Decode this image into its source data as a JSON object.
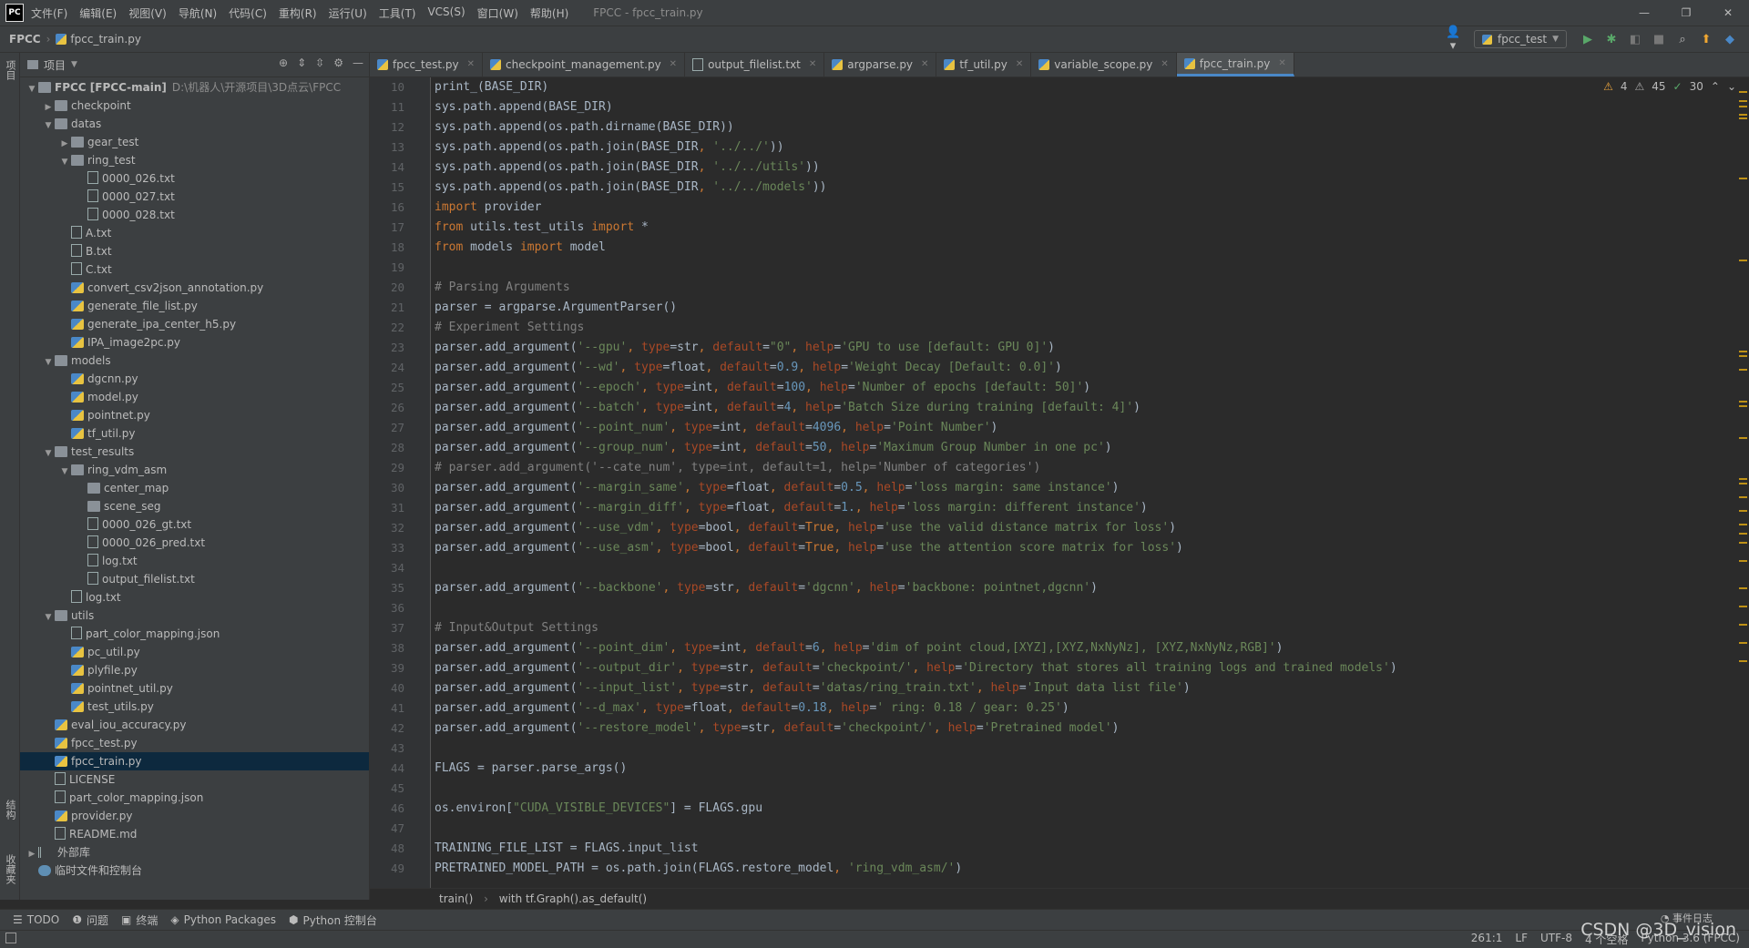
{
  "app": {
    "logo": "PC",
    "window_title": "FPCC - fpcc_train.py"
  },
  "menu": [
    "文件(F)",
    "编辑(E)",
    "视图(V)",
    "导航(N)",
    "代码(C)",
    "重构(R)",
    "运行(U)",
    "工具(T)",
    "VCS(S)",
    "窗口(W)",
    "帮助(H)"
  ],
  "window_controls": {
    "minimize": "—",
    "maximize": "❐",
    "close": "✕"
  },
  "nav": {
    "project": "FPCC",
    "file": "fpcc_train.py",
    "run_config": "fpcc_test"
  },
  "left_strip": {
    "top": "项目",
    "mid": "结构",
    "bottom": "收藏夹"
  },
  "project_panel": {
    "title": "项目",
    "tree": [
      {
        "depth": 0,
        "type": "folder",
        "open": true,
        "name": "FPCC [FPCC-main]",
        "path": "D:\\机器人\\开源项目\\3D点云\\FPCC"
      },
      {
        "depth": 1,
        "type": "folder",
        "open": false,
        "name": "checkpoint"
      },
      {
        "depth": 1,
        "type": "folder",
        "open": true,
        "name": "datas"
      },
      {
        "depth": 2,
        "type": "folder",
        "open": false,
        "name": "gear_test"
      },
      {
        "depth": 2,
        "type": "folder",
        "open": true,
        "name": "ring_test"
      },
      {
        "depth": 3,
        "type": "file",
        "name": "0000_026.txt"
      },
      {
        "depth": 3,
        "type": "file",
        "name": "0000_027.txt"
      },
      {
        "depth": 3,
        "type": "file",
        "name": "0000_028.txt"
      },
      {
        "depth": 2,
        "type": "file",
        "name": "A.txt"
      },
      {
        "depth": 2,
        "type": "file",
        "name": "B.txt"
      },
      {
        "depth": 2,
        "type": "file",
        "name": "C.txt"
      },
      {
        "depth": 2,
        "type": "py",
        "name": "convert_csv2json_annotation.py"
      },
      {
        "depth": 2,
        "type": "py",
        "name": "generate_file_list.py"
      },
      {
        "depth": 2,
        "type": "py",
        "name": "generate_ipa_center_h5.py"
      },
      {
        "depth": 2,
        "type": "py",
        "name": "IPA_image2pc.py"
      },
      {
        "depth": 1,
        "type": "folder",
        "open": true,
        "name": "models"
      },
      {
        "depth": 2,
        "type": "py",
        "name": "dgcnn.py"
      },
      {
        "depth": 2,
        "type": "py",
        "name": "model.py"
      },
      {
        "depth": 2,
        "type": "py",
        "name": "pointnet.py"
      },
      {
        "depth": 2,
        "type": "py",
        "name": "tf_util.py"
      },
      {
        "depth": 1,
        "type": "folder",
        "open": true,
        "name": "test_results"
      },
      {
        "depth": 2,
        "type": "folder",
        "open": true,
        "name": "ring_vdm_asm"
      },
      {
        "depth": 3,
        "type": "folder",
        "leaf": true,
        "name": "center_map"
      },
      {
        "depth": 3,
        "type": "folder",
        "leaf": true,
        "name": "scene_seg"
      },
      {
        "depth": 3,
        "type": "file",
        "name": "0000_026_gt.txt"
      },
      {
        "depth": 3,
        "type": "file",
        "name": "0000_026_pred.txt"
      },
      {
        "depth": 3,
        "type": "file",
        "name": "log.txt"
      },
      {
        "depth": 3,
        "type": "file",
        "name": "output_filelist.txt"
      },
      {
        "depth": 2,
        "type": "file",
        "name": "log.txt"
      },
      {
        "depth": 1,
        "type": "folder",
        "open": true,
        "name": "utils"
      },
      {
        "depth": 2,
        "type": "file",
        "name": "part_color_mapping.json"
      },
      {
        "depth": 2,
        "type": "py",
        "name": "pc_util.py"
      },
      {
        "depth": 2,
        "type": "py",
        "name": "plyfile.py"
      },
      {
        "depth": 2,
        "type": "py",
        "name": "pointnet_util.py"
      },
      {
        "depth": 2,
        "type": "py",
        "name": "test_utils.py"
      },
      {
        "depth": 1,
        "type": "py",
        "name": "eval_iou_accuracy.py"
      },
      {
        "depth": 1,
        "type": "py",
        "name": "fpcc_test.py"
      },
      {
        "depth": 1,
        "type": "py",
        "name": "fpcc_train.py",
        "selected": true
      },
      {
        "depth": 1,
        "type": "file",
        "name": "LICENSE"
      },
      {
        "depth": 1,
        "type": "file",
        "name": "part_color_mapping.json"
      },
      {
        "depth": 1,
        "type": "py",
        "name": "provider.py"
      },
      {
        "depth": 1,
        "type": "file",
        "name": "README.md"
      },
      {
        "depth": 0,
        "type": "lib",
        "open": false,
        "name": "外部库"
      },
      {
        "depth": 0,
        "type": "scratch",
        "name": "临时文件和控制台"
      }
    ]
  },
  "tabs": [
    {
      "label": "fpcc_test.py",
      "kind": "py"
    },
    {
      "label": "checkpoint_management.py",
      "kind": "py"
    },
    {
      "label": "output_filelist.txt",
      "kind": "txt"
    },
    {
      "label": "argparse.py",
      "kind": "py"
    },
    {
      "label": "tf_util.py",
      "kind": "py"
    },
    {
      "label": "variable_scope.py",
      "kind": "py"
    },
    {
      "label": "fpcc_train.py",
      "kind": "py",
      "active": true
    }
  ],
  "inspections": {
    "warnings_a": "4",
    "warnings_b": "45",
    "ok": "30"
  },
  "code_start_line": 10,
  "code": [
    "print_(BASE_DIR)",
    "sys.path.append(BASE_DIR)",
    "sys.path.append(os.path.dirname(BASE_DIR))",
    "sys.path.append(os.path.join(BASE_DIR, '../../'))",
    "sys.path.append(os.path.join(BASE_DIR, '../../utils'))",
    "sys.path.append(os.path.join(BASE_DIR, '../../models'))",
    "import provider",
    "from utils.test_utils import *",
    "from models import model",
    "",
    "# Parsing Arguments",
    "parser = argparse.ArgumentParser()",
    "# Experiment Settings",
    "parser.add_argument('--gpu', type=str, default=\"0\", help='GPU to use [default: GPU 0]')",
    "parser.add_argument('--wd', type=float, default=0.9, help='Weight Decay [Default: 0.0]')",
    "parser.add_argument('--epoch', type=int, default=100, help='Number of epochs [default: 50]')",
    "parser.add_argument('--batch', type=int, default=4, help='Batch Size during training [default: 4]')",
    "parser.add_argument('--point_num', type=int, default=4096, help='Point Number')",
    "parser.add_argument('--group_num', type=int, default=50, help='Maximum Group Number in one pc')",
    "# parser.add_argument('--cate_num', type=int, default=1, help='Number of categories')",
    "parser.add_argument('--margin_same', type=float, default=0.5, help='loss margin: same instance')",
    "parser.add_argument('--margin_diff', type=float, default=1., help='loss margin: different instance')",
    "parser.add_argument('--use_vdm', type=bool, default=True, help='use the valid distance matrix for loss')",
    "parser.add_argument('--use_asm', type=bool, default=True, help='use the attention score matrix for loss')",
    "",
    "parser.add_argument('--backbone', type=str, default='dgcnn', help='backbone: pointnet,dgcnn')",
    "",
    "# Input&Output Settings",
    "parser.add_argument('--point_dim', type=int, default=6, help='dim of point cloud,[XYZ],[XYZ,NxNyNz], [XYZ,NxNyNz,RGB]')",
    "parser.add_argument('--output_dir', type=str, default='checkpoint/', help='Directory that stores all training logs and trained models')",
    "parser.add_argument('--input_list', type=str, default='datas/ring_train.txt', help='Input data list file')",
    "parser.add_argument('--d_max', type=float, default=0.18, help=' ring: 0.18 / gear: 0.25')",
    "parser.add_argument('--restore_model', type=str, default='checkpoint/', help='Pretrained model')",
    "",
    "FLAGS = parser.parse_args()",
    "",
    "os.environ[\"CUDA_VISIBLE_DEVICES\"] = FLAGS.gpu",
    "",
    "TRAINING_FILE_LIST = FLAGS.input_list",
    "PRETRAINED_MODEL_PATH = os.path.join(FLAGS.restore_model, 'ring_vdm_asm/')"
  ],
  "breadcrumb": {
    "a": "train()",
    "b": "with tf.Graph().as_default()"
  },
  "tool_windows": [
    {
      "icon": "☰",
      "label": "TODO"
    },
    {
      "icon": "❶",
      "label": "问题"
    },
    {
      "icon": "▣",
      "label": "终端"
    },
    {
      "icon": "◈",
      "label": "Python Packages"
    },
    {
      "icon": "⬢",
      "label": "Python 控制台"
    }
  ],
  "event_log": "事件日志",
  "status": {
    "pos": "261:1",
    "eol": "LF",
    "enc": "UTF-8",
    "indent": "4 个空格",
    "interp": "Python 3.6 (FPCC)"
  },
  "watermark": "CSDN @3D_vision"
}
